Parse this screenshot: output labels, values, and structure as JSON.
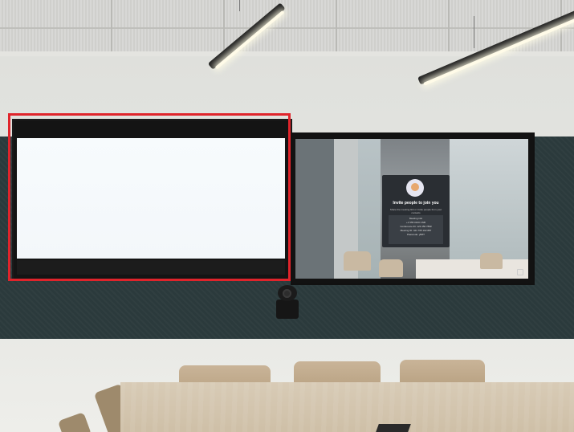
{
  "invite": {
    "title": "Invite people to join you",
    "subtitle": "Share the meeting link or invite people from your contacts",
    "details_label": "Meeting info",
    "line1": "+1 555 0100 CNB",
    "line2": "Conference ID: 123 456 789#",
    "line3": "Meeting ID: 421 765 102 887",
    "line4": "Passcode: yBZT"
  },
  "colors": {
    "highlight_box": "#e0242b",
    "acoustic_panel": "#2b3a3c",
    "shared_screen": "#f5f9fb"
  }
}
